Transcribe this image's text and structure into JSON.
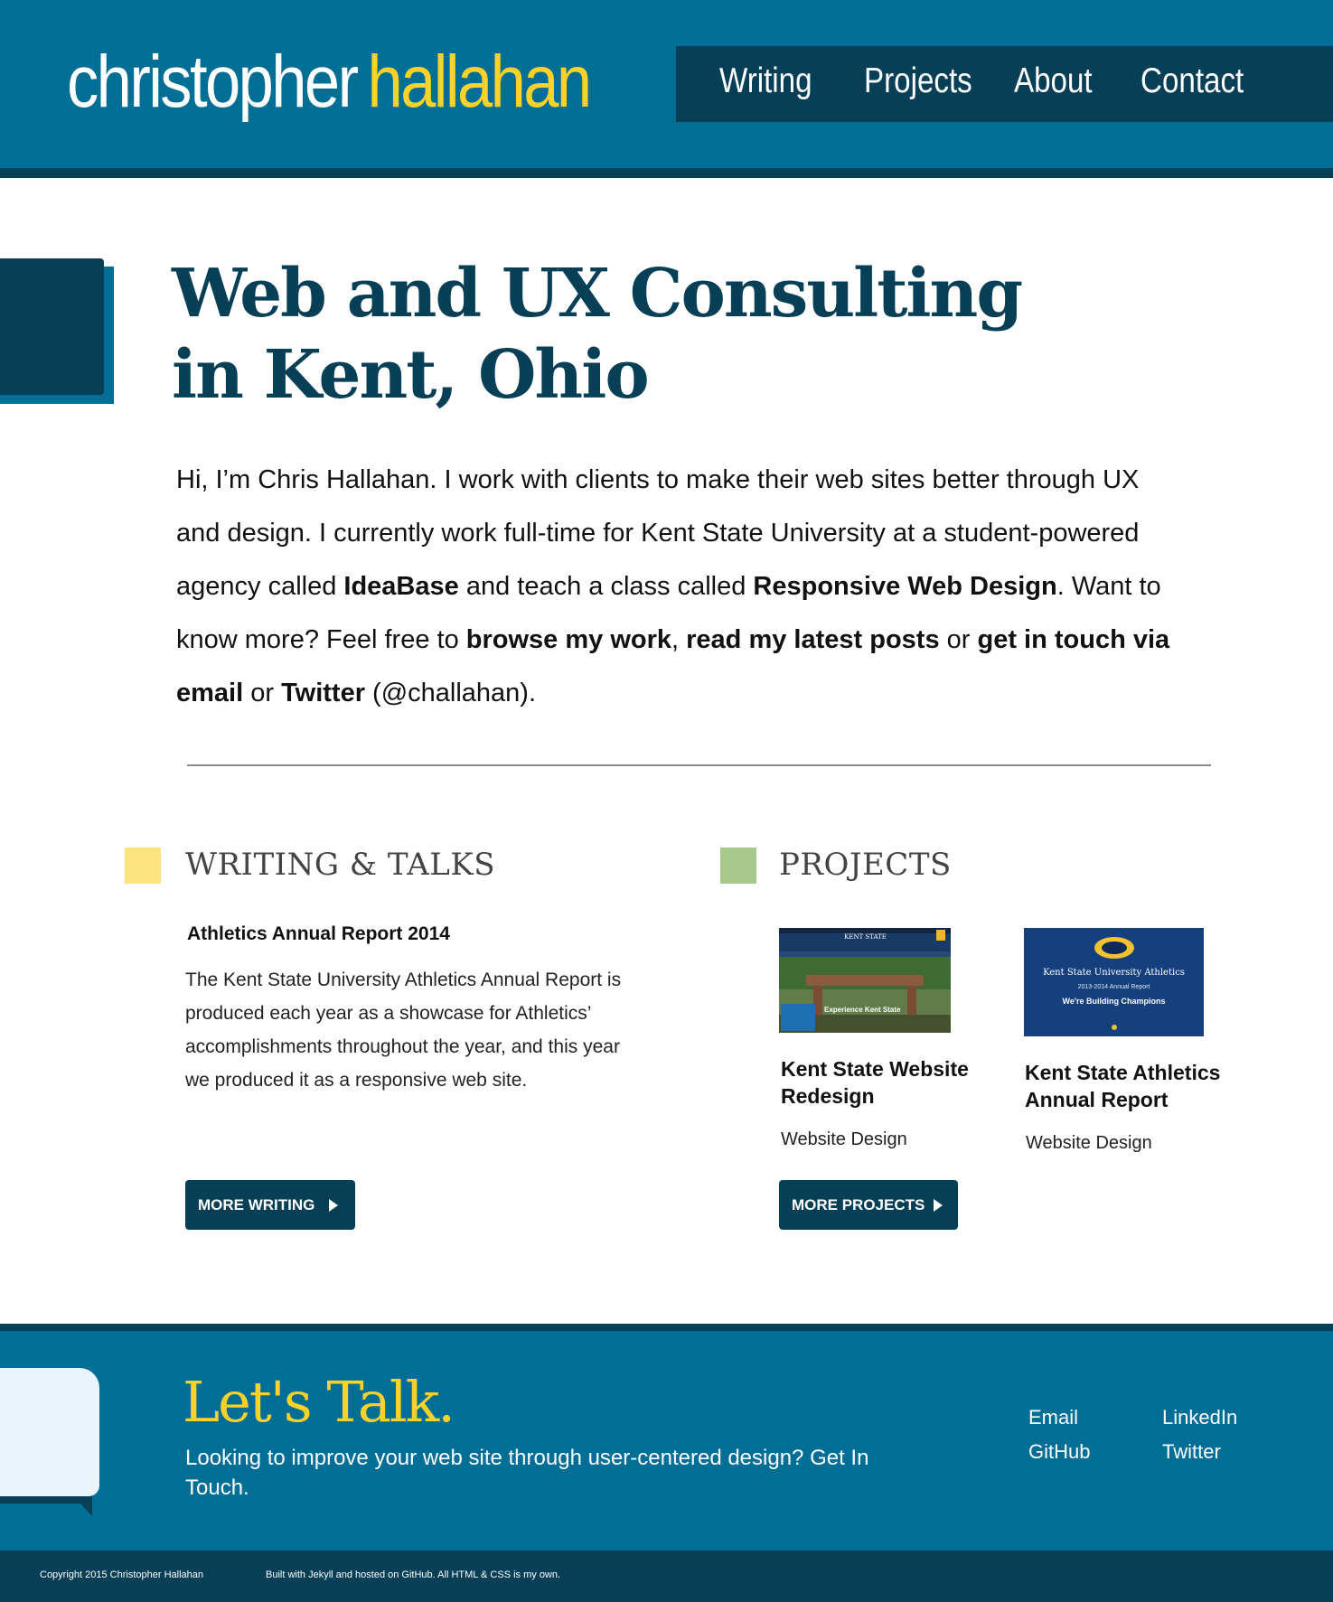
{
  "header": {
    "logo_first": "christopher",
    "logo_last": "hallahan",
    "nav": [
      "Writing",
      "Projects",
      "About",
      "Contact"
    ]
  },
  "hero": {
    "title": "Web and UX Consulting in Kent, Ohio",
    "intro": {
      "t1": "Hi, I’m Chris Hallahan.  I work with clients to make their web sites better through UX and design.  I currently work full-time for Kent State University at a student-powered agency called ",
      "b1": "IdeaBase",
      "t2": " and teach a class called ",
      "b2": "Responsive Web Design",
      "t3": ". Want to know more? Feel free to ",
      "b3": "browse my work",
      "t4": ", ",
      "b4": "read my latest posts",
      "t5": " or ",
      "b5": "get in touch via email",
      "t6": " or ",
      "b6": "Twitter",
      "t7": " (@challahan)."
    }
  },
  "writing": {
    "heading": "WRITING & TALKS",
    "post_title": "Athletics Annual Report 2014",
    "post_excerpt": "The Kent State University Athletics Annual Report is produced each year as a showcase for Athletics’ accomplishments throughout the year, and this year we produced it as a responsive web site.",
    "button": "MORE WRITING"
  },
  "projects": {
    "heading": "PROJECTS",
    "items": [
      {
        "title": "Kent State Website Redesign",
        "category": "Website Design",
        "thumb_caption": "Experience Kent State",
        "thumb_logo": "KENT STATE"
      },
      {
        "title": "Kent State Athletics Annual Report",
        "category": "Website Design",
        "thumb_line1": "Kent State University Athletics",
        "thumb_line2": "2013-2014 Annual Report",
        "thumb_line3": "We're Building Champions"
      }
    ],
    "button": "MORE PROJECTS"
  },
  "footer": {
    "title": "Let's Talk.",
    "text": "Looking to improve your web site through user-centered design? Get In Touch.",
    "links": [
      "Email",
      "LinkedIn",
      "GitHub",
      "Twitter"
    ],
    "copyright": "Copyright 2015 Christopher Hallahan",
    "built_with": "Built with Jekyll and hosted on GitHub.  All HTML & CSS is my own."
  },
  "colors": {
    "primary_blue": "#016e96",
    "dark_navy": "#073f56",
    "brand_yellow": "#fcd12a",
    "writing_square": "#fde47e",
    "projects_square": "#a8c98d",
    "bubble": "#e9f4fb"
  }
}
